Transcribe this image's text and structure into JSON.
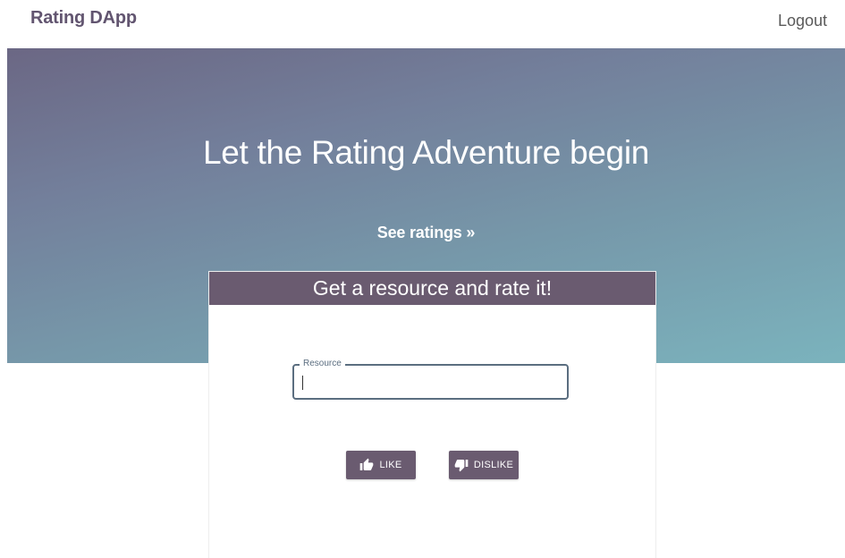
{
  "navbar": {
    "brand": "Rating DApp",
    "logout": "Logout"
  },
  "hero": {
    "title": "Let the Rating Adventure begin",
    "see_ratings": "See ratings »"
  },
  "card": {
    "header": "Get a resource and rate it!",
    "resource_field": {
      "label": "Resource",
      "value": "",
      "placeholder": ""
    },
    "like_button": {
      "label": "LIKE",
      "icon": "thumbs-up-icon"
    },
    "dislike_button": {
      "label": "DISLIKE",
      "icon": "thumbs-down-icon"
    }
  },
  "colors": {
    "brand": "#625570",
    "primary": "#6a5b70",
    "hero_gradient_start": "#6b6784",
    "hero_gradient_end": "#7bb3bd",
    "field_border": "#5b6e80"
  }
}
